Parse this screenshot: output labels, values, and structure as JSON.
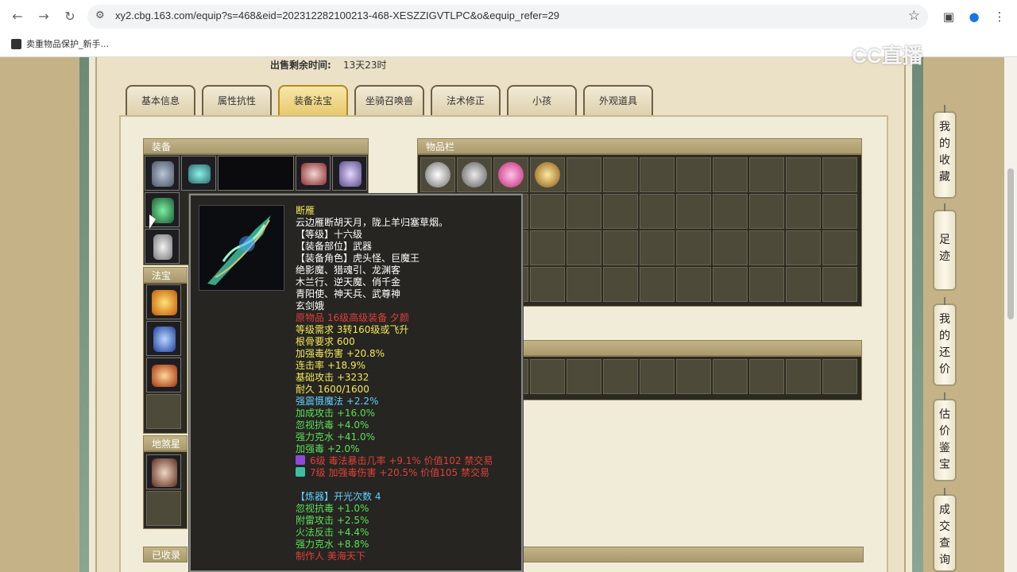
{
  "browser": {
    "url": "xy2.cbg.163.com/equip?s=468&eid=202312282100213-468-XESZZIGVTLPC&o&equip_refer=29",
    "bookmark_label": "卖重物品保护_新手..."
  },
  "watermark": "CC直播",
  "sale": {
    "label": "出售剩余时间:",
    "value": "13天23时"
  },
  "tabs": [
    {
      "label": "基本信息",
      "active": false
    },
    {
      "label": "属性抗性",
      "active": false
    },
    {
      "label": "装备法宝",
      "active": true
    },
    {
      "label": "坐骑召唤兽",
      "active": false
    },
    {
      "label": "法术修正",
      "active": false
    },
    {
      "label": "小孩",
      "active": false
    },
    {
      "label": "外观道具",
      "active": false
    }
  ],
  "panels": {
    "equipment": "装备",
    "inventory": "物品栏",
    "treasure": "法宝",
    "earth_star": "地煞星",
    "collected": "已收录"
  },
  "tooltip": {
    "lines": [
      {
        "text": "断雁",
        "color": "#f2e85a"
      },
      {
        "text": "云边雁断胡天月，陇上羊归塞草烟。",
        "color": "#ffffff"
      },
      {
        "text": "【等级】十六级",
        "color": "#ffffff"
      },
      {
        "text": "【装备部位】武器",
        "color": "#ffffff"
      },
      {
        "text": "【装备角色】虎头怪、巨魔王",
        "color": "#ffffff"
      },
      {
        "text": "绝影魔、猎魂引、龙渊客",
        "color": "#ffffff"
      },
      {
        "text": "木兰行、逆天魔、俏千金",
        "color": "#ffffff"
      },
      {
        "text": "青阳使、神天兵、武尊神",
        "color": "#ffffff"
      },
      {
        "text": "玄剑娥",
        "color": "#ffffff"
      },
      {
        "text": "原物品 16级高级装备 夕颜",
        "color": "#e0403a"
      },
      {
        "text": "等级需求 3转160级或飞升",
        "color": "#f2e85a"
      },
      {
        "text": "根骨要求 600",
        "color": "#f2e85a"
      },
      {
        "text": "加强毒伤害 +20.8%",
        "color": "#f2e85a"
      },
      {
        "text": "连击率 +18.9%",
        "color": "#f2e85a"
      },
      {
        "text": "基础攻击 +3232",
        "color": "#f2e85a"
      },
      {
        "text": "耐久 1600/1600",
        "color": "#f2e85a"
      },
      {
        "text": "强震慑魔法 +2.2%",
        "color": "#5fd0ff"
      },
      {
        "text": "加成攻击 +16.0%",
        "color": "#5ae05a"
      },
      {
        "text": "忽视抗毒 +4.0%",
        "color": "#5ae05a"
      },
      {
        "text": "强力克水 +41.0%",
        "color": "#5ae05a"
      },
      {
        "text": "加强毒 +2.0%",
        "color": "#5ae05a"
      },
      {
        "text": "6级 毒法暴击几率 +9.1% 价值102 禁交易",
        "color": "#e0403a",
        "gem": "#8b4bd8"
      },
      {
        "text": "7级 加强毒伤害 +20.5% 价值105 禁交易",
        "color": "#e0403a",
        "gem": "#3fbfa0"
      },
      {
        "text": "",
        "color": "#ffffff"
      },
      {
        "text": "【炼器】开光次数 4",
        "color": "#5fd0ff"
      },
      {
        "text": "忽视抗毒 +1.0%",
        "color": "#5ae05a"
      },
      {
        "text": "附雷攻击 +2.5%",
        "color": "#5ae05a"
      },
      {
        "text": "火法反击 +4.4%",
        "color": "#5ae05a"
      },
      {
        "text": "强力克水 +8.8%",
        "color": "#5ae05a"
      },
      {
        "text": "制作人 美海天下",
        "color": "#e0403a"
      }
    ]
  },
  "sidebar": [
    {
      "label": "我的收藏"
    },
    {
      "label": "足迹"
    },
    {
      "label": "我的还价"
    },
    {
      "label": "估价鉴宝"
    },
    {
      "label": "成交查询"
    }
  ]
}
